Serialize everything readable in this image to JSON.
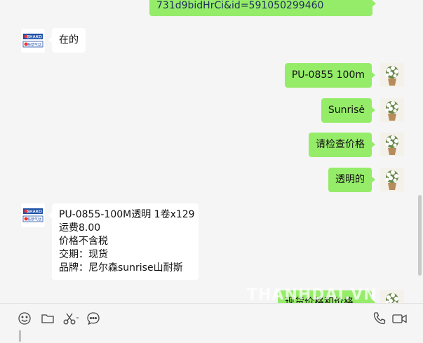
{
  "messages": {
    "m0": {
      "text": "731d9bidHrCi&id=591050299460"
    },
    "m1": {
      "text": "在的"
    },
    "m2": {
      "text": "PU-0855 100m"
    },
    "m3": {
      "text": "Sunrisė"
    },
    "m4": {
      "text": "请检查价格"
    },
    "m5": {
      "text": "透明的"
    },
    "m6": {
      "lines": [
        "PU-0855-100M透明 1卷x129",
        "运费8.00",
        "价格不含税",
        "交期：现货",
        "品牌：尼尔森sunrise山耐斯"
      ]
    },
    "m7": {
      "text": "现货价格和价格"
    }
  },
  "contact_logo": {
    "top": "SHAKO",
    "bottom": "新恭气动"
  },
  "watermark": "THANHDAI.VN",
  "toolbar": {
    "icons": [
      "emoji-icon",
      "folder-icon",
      "scissors-icon",
      "chat-history-icon",
      "phone-icon",
      "video-icon"
    ]
  },
  "colors": {
    "outgoing": "#95ec69",
    "incoming": "#ffffff",
    "background": "#f5f5f5"
  }
}
